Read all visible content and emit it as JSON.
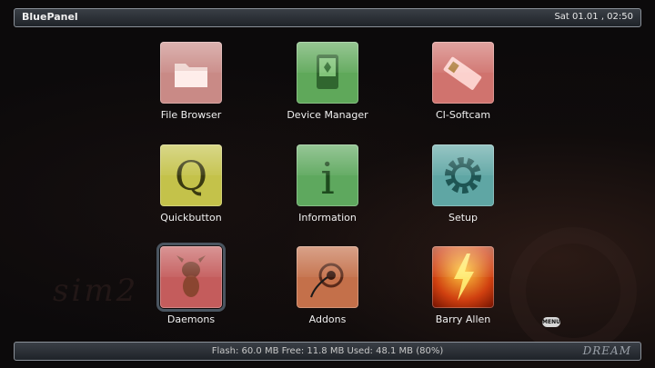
{
  "header": {
    "title": "BluePanel",
    "clock": "Sat 01.01 , 02:50"
  },
  "watermark": "sim2",
  "tiles": [
    {
      "label": "File Browser",
      "color": "#c98a86",
      "icon": "folder-icon"
    },
    {
      "label": "Device Manager",
      "color": "#5fa85a",
      "icon": "device-icon"
    },
    {
      "label": "CI-Softcam",
      "color": "#d0736e",
      "icon": "card-icon"
    },
    {
      "label": "Quickbutton",
      "color": "#c4c24a",
      "icon": "q-icon"
    },
    {
      "label": "Information",
      "color": "#5ea85e",
      "icon": "info-icon"
    },
    {
      "label": "Setup",
      "color": "#5fa6a4",
      "icon": "gear-icon"
    },
    {
      "label": "Daemons",
      "color": "#c45c5c",
      "icon": "mascot-icon"
    },
    {
      "label": "Addons",
      "color": "#c4704a",
      "icon": "plug-icon"
    },
    {
      "label": "Barry Allen",
      "color": "#c84a1a",
      "icon": "flash-icon"
    }
  ],
  "menu_badge": "MENU",
  "footer": {
    "info": "Flash: 60.0 MB  Free: 11.8 MB  Used: 48.1 MB (80%)",
    "brand": "DREAM"
  }
}
